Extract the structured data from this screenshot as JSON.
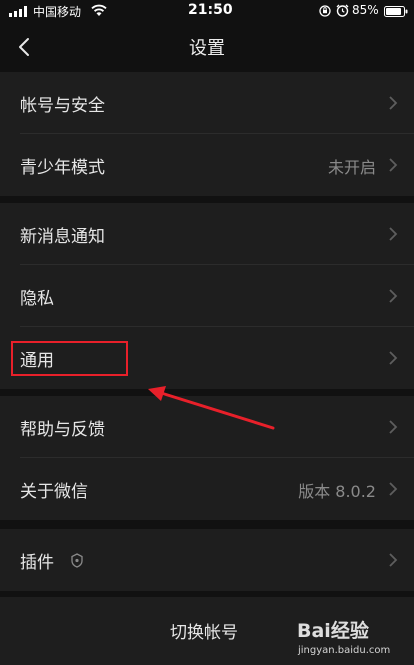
{
  "status_bar": {
    "carrier": "中国移动",
    "time": "21:50",
    "battery": "85%"
  },
  "nav": {
    "title": "设置"
  },
  "groups": [
    {
      "items": [
        {
          "label": "帐号与安全",
          "value": ""
        },
        {
          "label": "青少年模式",
          "value": "未开启"
        }
      ]
    },
    {
      "items": [
        {
          "label": "新消息通知",
          "value": ""
        },
        {
          "label": "隐私",
          "value": ""
        },
        {
          "label": "通用",
          "value": ""
        }
      ]
    },
    {
      "items": [
        {
          "label": "帮助与反馈",
          "value": ""
        },
        {
          "label": "关于微信",
          "value": "版本 8.0.2"
        }
      ]
    },
    {
      "items": [
        {
          "label": "插件",
          "value": "",
          "icon": "plugin-icon"
        }
      ]
    }
  ],
  "footer": {
    "switch_account": "切换帐号"
  },
  "annotation": {
    "highlight_color": "#e8202a",
    "highlighted_item": "通用"
  },
  "watermark": {
    "brand": "Bai经验",
    "url": "jingyan.baidu.com"
  },
  "colors": {
    "background": "#111111",
    "row_background": "#1e1e1e",
    "text": "#e6e6e6",
    "secondary_text": "#8a8a8a"
  }
}
